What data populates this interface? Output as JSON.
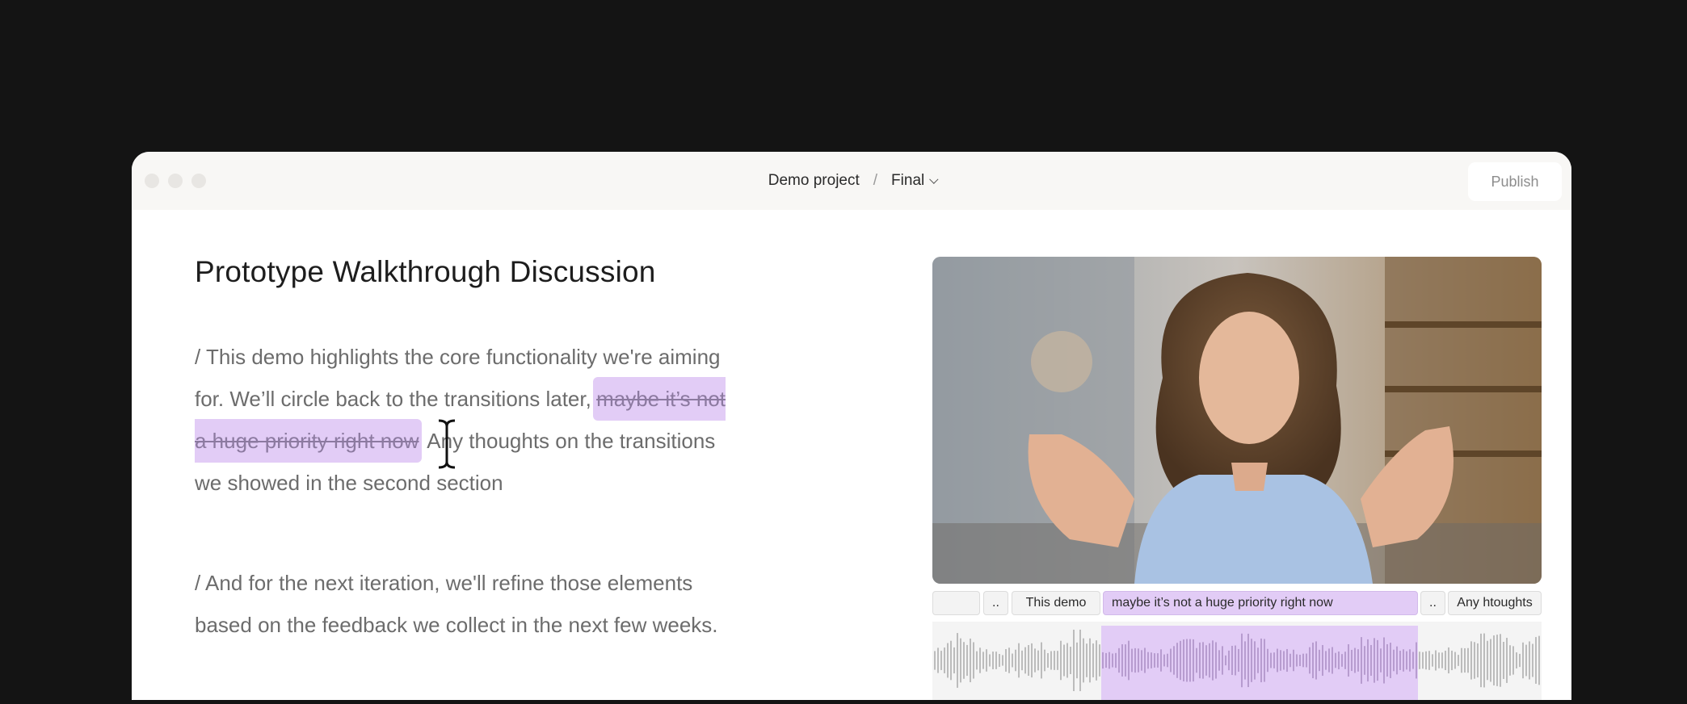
{
  "titlebar": {
    "project": "Demo project",
    "separator": "/",
    "version": "Final",
    "publish_label": "Publish"
  },
  "document": {
    "title": "Prototype Walkthrough Discussion",
    "paragraph1": {
      "before": "/ This demo highlights the core functionality we're aiming for. We’ll circle back to the transitions later,",
      "highlighted": "maybe it’s not a huge priority right now",
      "after": "Any thoughts on the transitions we showed in the second section"
    },
    "paragraph2": "/ And for the next iteration, we'll refine those elements based on the feedback we collect in the next few weeks."
  },
  "timeline": {
    "segments": [
      "",
      "..",
      "This demo",
      "maybe it’s not a huge priority right now",
      "..",
      "Any htoughts"
    ],
    "selected_index": 3
  },
  "colors": {
    "highlight": "#e2ccf6",
    "background": "#141414"
  },
  "icons": [
    "text-cursor-icon",
    "chevron-down-icon"
  ]
}
